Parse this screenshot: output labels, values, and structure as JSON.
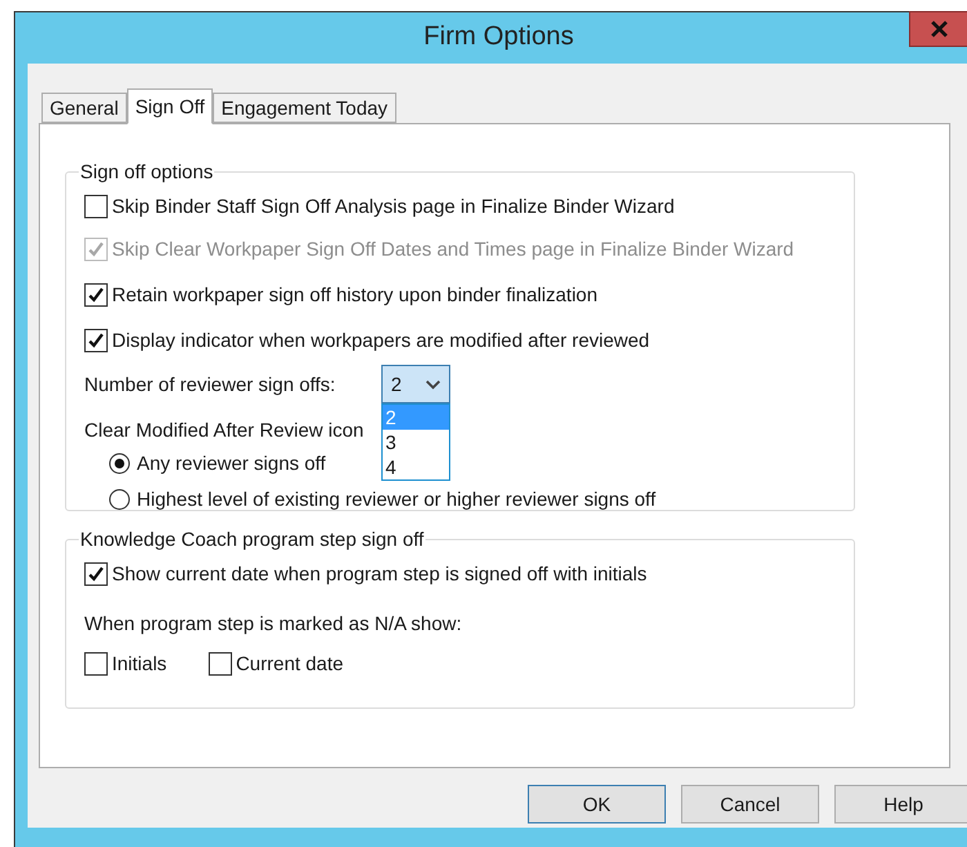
{
  "window": {
    "title": "Firm Options"
  },
  "tabs": [
    {
      "label": "General",
      "selected": false
    },
    {
      "label": "Sign Off",
      "selected": true
    },
    {
      "label": "Engagement Today",
      "selected": false
    }
  ],
  "sign_off_options": {
    "title": "Sign off options",
    "options": [
      {
        "label": "Skip Binder Staff Sign Off Analysis page in Finalize Binder Wizard",
        "checked": false,
        "disabled": false
      },
      {
        "label": "Skip Clear Workpaper Sign Off Dates and Times page in Finalize Binder Wizard",
        "checked": true,
        "disabled": true
      },
      {
        "label": "Retain workpaper sign off history upon binder finalization",
        "checked": true,
        "disabled": false
      },
      {
        "label": "Display indicator when workpapers are modified after reviewed",
        "checked": true,
        "disabled": false
      }
    ],
    "reviewer_sign_offs": {
      "label": "Number of reviewer sign offs:",
      "value": "2",
      "expanded": true,
      "items": [
        {
          "label": "2",
          "selected": true
        },
        {
          "label": "3",
          "selected": false
        },
        {
          "label": "4",
          "selected": false
        }
      ]
    },
    "clear_modified": {
      "label": "Clear Modified After Review icon",
      "radios": [
        {
          "label": "Any reviewer signs off",
          "selected": true
        },
        {
          "label": "Highest level of existing reviewer or higher reviewer signs off",
          "selected": false
        }
      ]
    }
  },
  "knowledge_coach": {
    "title": "Knowledge Coach program step sign off",
    "option": {
      "label": "Show current date when program step is signed off with initials",
      "checked": true
    },
    "na_label": "When program step is marked as N/A show:",
    "na_options": [
      {
        "label": "Initials",
        "checked": false
      },
      {
        "label": "Current date",
        "checked": false
      }
    ]
  },
  "buttons": [
    {
      "label": "OK",
      "default": true
    },
    {
      "label": "Cancel",
      "default": false
    },
    {
      "label": "Help",
      "default": false
    }
  ]
}
